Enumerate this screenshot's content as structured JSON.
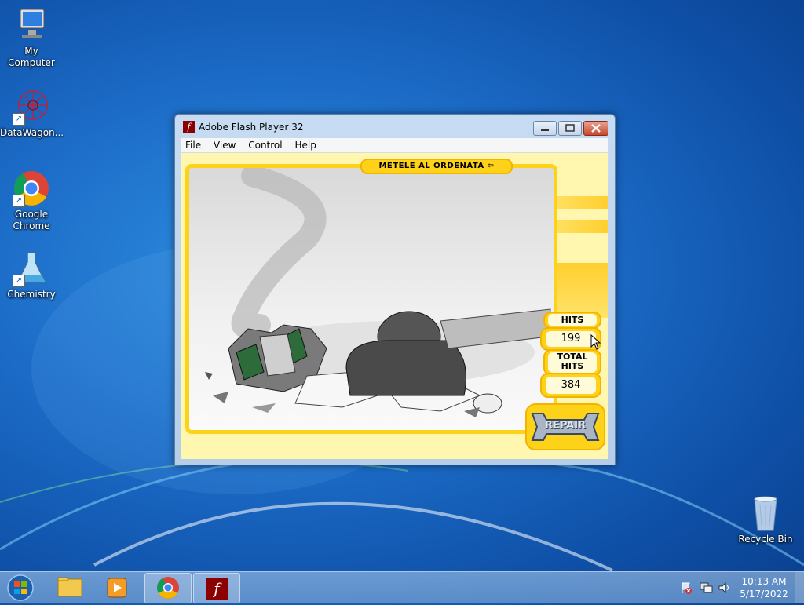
{
  "desktop": {
    "icons": [
      {
        "label": "My Computer",
        "icon": "computer-icon"
      },
      {
        "label": "DataWagon...",
        "icon": "molecule-icon"
      },
      {
        "label": "Google Chrome",
        "icon": "chrome-icon"
      },
      {
        "label": "Chemistry",
        "icon": "flask-icon"
      },
      {
        "label": "Recycle Bin",
        "icon": "recycle-bin-icon"
      }
    ]
  },
  "window": {
    "title": "Adobe Flash Player 32",
    "menu": [
      "File",
      "View",
      "Control",
      "Help"
    ]
  },
  "game": {
    "banner": "METELE AL ORDENATA",
    "hits_label": "HITS",
    "hits_value": "199",
    "total_hits_label_1": "TOTAL",
    "total_hits_label_2": "HITS",
    "total_hits_value": "384",
    "repair_label": "REPAIR"
  },
  "taskbar": {
    "items": [
      "start-orb",
      "file-explorer",
      "media-player",
      "chrome",
      "flash-player"
    ],
    "clock_time": "10:13 AM",
    "clock_date": "5/17/2022"
  },
  "colors": {
    "accent_yellow": "#ffd21a",
    "panel_yellow": "#fff7b0",
    "wallpaper_blue": "#1c6cc7"
  }
}
